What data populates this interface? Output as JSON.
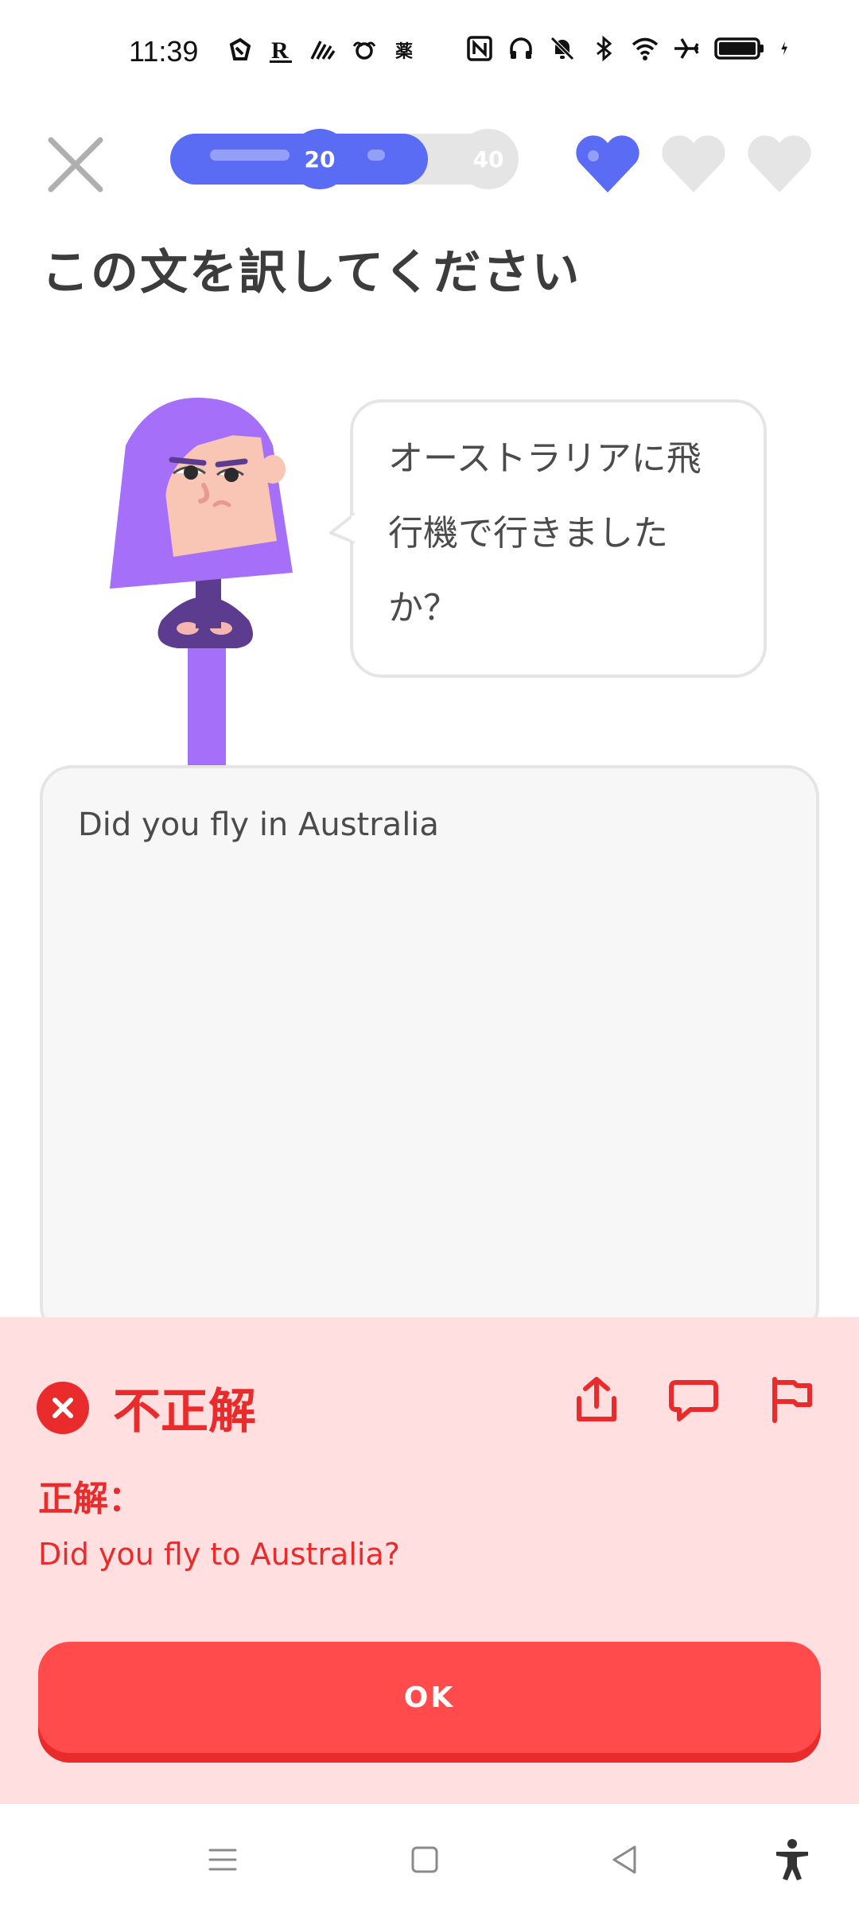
{
  "status_bar": {
    "time": "11:39",
    "left_icons": [
      "app-icon-1",
      "app-icon-r",
      "app-icon-3",
      "app-icon-4",
      "app-icon-kanji"
    ],
    "left_icon_text": "薬",
    "right_icons": [
      "nfc-icon",
      "headphones-icon",
      "mute-icon",
      "bluetooth-icon",
      "wifi-icon",
      "airplane-icon",
      "battery-icon",
      "charging-icon"
    ]
  },
  "lesson": {
    "progress_fraction": 0.75,
    "milestone_1": "20",
    "milestone_2": "40",
    "hearts_total": 3,
    "hearts_filled": 1,
    "accent_color": "#5b6cf4"
  },
  "prompt": {
    "title": "この文を訳してください",
    "sentence_line1": "オーストラリアに飛",
    "sentence_line2": "行機で行きました",
    "sentence_line3": "か？"
  },
  "answer": {
    "user_text": "Did you fly in Australia"
  },
  "feedback": {
    "status": "不正解",
    "correct_label": "正解：",
    "correct_answer": "Did you fly to Australia?",
    "ok_label": "OK",
    "error_color": "#ea2b2b",
    "background_color": "#ffdfe0"
  },
  "nav": {
    "items": [
      "menu-icon",
      "home-icon",
      "back-icon",
      "accessibility-icon"
    ]
  }
}
